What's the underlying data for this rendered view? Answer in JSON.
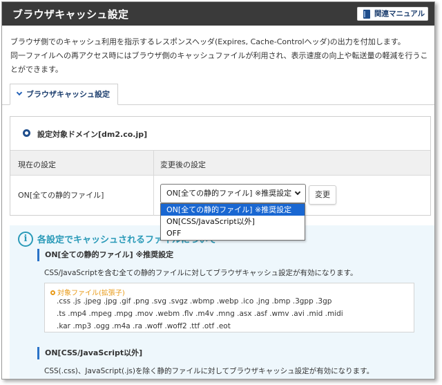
{
  "header": {
    "title": "ブラウザキャッシュ設定",
    "manual_label": "関連マニュアル"
  },
  "description": {
    "line1": "ブラウザ側でのキャッシュ利用を指示するレスポンスヘッダ(Expires, Cache-Controlヘッダ)の出力を付加します。",
    "line2": "同一ファイルへの再アクセス時にはブラウザ側のキャッシュファイルが利用され、表示速度の向上や転送量の軽減を行うこ",
    "line3": "とができます。"
  },
  "tab": {
    "label": "ブラウザキャッシュ設定"
  },
  "settings": {
    "domain_label": "設定対象ドメイン[dm2.co.jp]",
    "col_current": "現在の設定",
    "col_new": "変更後の設定",
    "current_value": "ON[全ての静的ファイル]",
    "select_value": "ON[全ての静的ファイル] ※推奨設定",
    "change_button": "変更",
    "options": [
      "ON[全ての静的ファイル] ※推奨設定",
      "ON[CSS/JavaScript以外]",
      "OFF"
    ]
  },
  "info": {
    "icon": "i",
    "title": "各設定でキャッシュされるファイルについて",
    "section1": {
      "heading": "ON[全ての静的ファイル] ※推奨設定",
      "desc": "CSS/JavaScriptを含む全ての静的ファイルに対してブラウザキャッシュ設定が有効になります。",
      "ext_label": "対象ファイル(拡張子)",
      "ext_line1": ".css .js .jpeg .jpg .gif .png .svg .svgz .wbmp .webp .ico .jng .bmp .3gpp .3gp",
      "ext_line2": ".ts .mp4 .mpeg .mpg .mov .webm .flv .m4v .mng .asx .asf .wmv .avi .mid .midi",
      "ext_line3": ".kar .mp3 .ogg .m4a .ra .woff .woff2 .ttf .otf .eot"
    },
    "section2": {
      "heading": "ON[CSS/JavaScript以外]",
      "desc": "CSS(.css)、JavaScript(.js)を除く静的ファイルに対してブラウザキャッシュ設定が有効になります。"
    }
  }
}
